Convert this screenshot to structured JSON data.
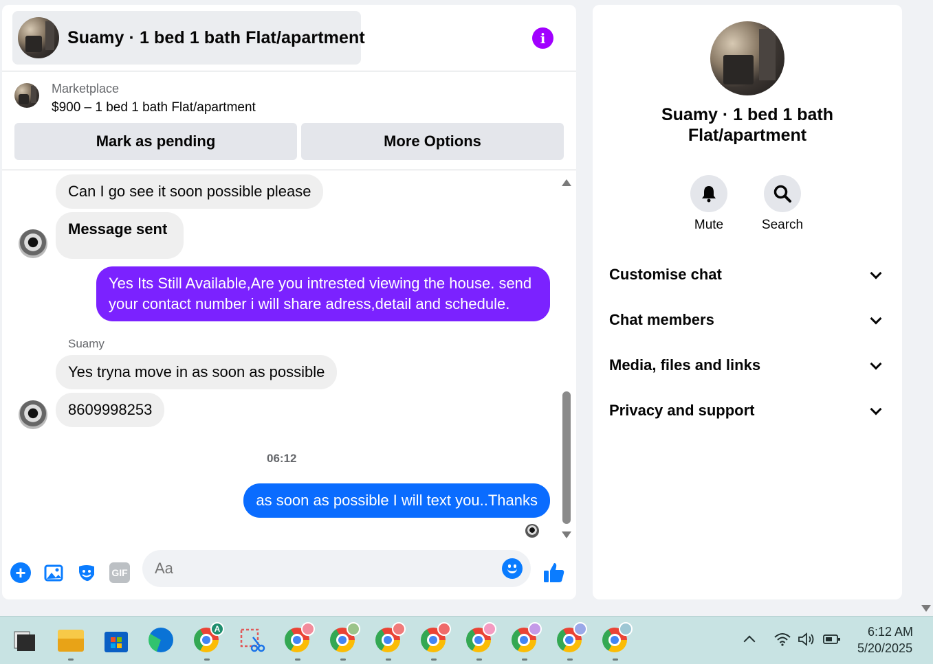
{
  "chat": {
    "title": "Suamy · 1 bed 1 bath Flat/apartment",
    "info_icon": "i",
    "listing": {
      "source": "Marketplace",
      "price_line": "$900 – 1 bed 1 bath Flat/apartment"
    },
    "buttons": {
      "mark_pending": "Mark as pending",
      "more_options": "More Options"
    },
    "messages": [
      {
        "direction": "in",
        "text": "Can I go see it soon possible please"
      },
      {
        "direction": "in",
        "text": "Message sent"
      },
      {
        "direction": "out",
        "text": "Yes Its Still Available,Are you intrested viewing the house. send your contact number i will share adress,detail and schedule."
      },
      {
        "direction": "in",
        "sender": "Suamy",
        "text": "Yes tryna move in as soon as possible"
      },
      {
        "direction": "in",
        "text": "8609998253"
      },
      {
        "direction": "out",
        "text": "as soon as possible I will text you..Thanks"
      }
    ],
    "timestamp": "06:12",
    "composer": {
      "placeholder": "Aa",
      "gif_label": "GIF"
    },
    "colors": {
      "purple_bubble": "#7b22ff",
      "blue_bubble": "#0a6cff",
      "accent": "#a100ff"
    }
  },
  "info_panel": {
    "name": "Suamy · 1 bed 1 bath Flat/apartment",
    "actions": [
      {
        "label": "Mute",
        "icon": "bell-icon"
      },
      {
        "label": "Search",
        "icon": "search-icon"
      }
    ],
    "sections": [
      {
        "label": "Customise chat"
      },
      {
        "label": "Chat members"
      },
      {
        "label": "Media, files and links"
      },
      {
        "label": "Privacy and support"
      }
    ]
  },
  "taskbar": {
    "apps": [
      {
        "icon": "start-icon"
      },
      {
        "icon": "file-explorer-icon"
      },
      {
        "icon": "microsoft-store-icon"
      },
      {
        "icon": "edge-icon"
      },
      {
        "icon": "chrome-icon",
        "badge": "A"
      },
      {
        "icon": "snipping-tool-icon"
      },
      {
        "icon": "chrome-icon"
      },
      {
        "icon": "chrome-icon"
      },
      {
        "icon": "chrome-icon"
      },
      {
        "icon": "chrome-icon"
      },
      {
        "icon": "chrome-icon"
      },
      {
        "icon": "chrome-icon"
      },
      {
        "icon": "chrome-icon"
      },
      {
        "icon": "chrome-icon"
      }
    ],
    "time": "6:12 AM",
    "date": "5/20/2025"
  }
}
